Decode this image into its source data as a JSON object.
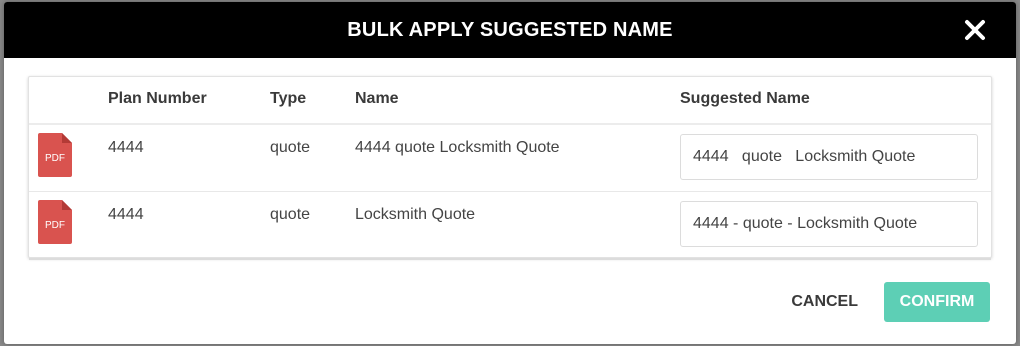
{
  "dialog": {
    "title": "BULK APPLY SUGGESTED NAME",
    "close_icon": "close-icon"
  },
  "table": {
    "columns": [
      "Plan Number",
      "Type",
      "Name",
      "Suggested Name"
    ],
    "rows": [
      {
        "icon_label": "PDF",
        "plan_number": "4444",
        "type": "quote",
        "name": "4444 quote Locksmith Quote",
        "suggested_name": "4444   quote   Locksmith Quote"
      },
      {
        "icon_label": "PDF",
        "plan_number": "4444",
        "type": "quote",
        "name": "Locksmith Quote",
        "suggested_name": "4444 - quote - Locksmith Quote"
      }
    ]
  },
  "footer": {
    "cancel_label": "CANCEL",
    "confirm_label": "CONFIRM"
  },
  "colors": {
    "header_bg": "#000000",
    "confirm_bg": "#5dcfb5",
    "pdf_red": "#d9534f"
  }
}
